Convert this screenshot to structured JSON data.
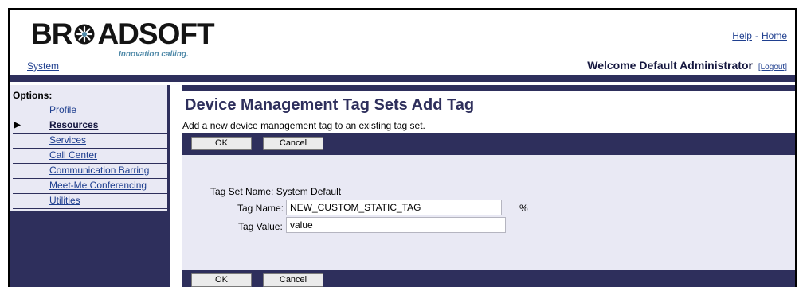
{
  "brand": {
    "logo_text_left": "BR",
    "logo_text_right": "ADSOFT",
    "tagline": "Innovation calling."
  },
  "header": {
    "help_label": "Help",
    "link_separator": "-",
    "home_label": "Home",
    "system_label": "System",
    "welcome_text": "Welcome Default Administrator",
    "logout_label": "[Logout]"
  },
  "sidebar": {
    "options_label": "Options:",
    "items": [
      {
        "label": "Profile",
        "active": false
      },
      {
        "label": "Resources",
        "active": true
      },
      {
        "label": "Services",
        "active": false
      },
      {
        "label": "Call Center",
        "active": false
      },
      {
        "label": "Communication Barring",
        "active": false
      },
      {
        "label": "Meet-Me Conferencing",
        "active": false
      },
      {
        "label": "Utilities",
        "active": false
      }
    ]
  },
  "main": {
    "title": "Device Management Tag Sets Add Tag",
    "description": "Add a new device management tag to an existing tag set.",
    "ok_label": "OK",
    "cancel_label": "Cancel",
    "form": {
      "tag_set_name_label": "Tag Set Name:",
      "tag_set_name_value": "System Default",
      "tag_name_label": "Tag Name:",
      "tag_name_prefix": "%",
      "tag_name_value": "NEW_CUSTOM_STATIC_TAG",
      "tag_name_suffix": "%",
      "tag_value_label": "Tag Value:",
      "tag_value_value": "value"
    }
  },
  "colors": {
    "dark_navy": "#2e2f5c",
    "panel_lavender": "#e9e9f4",
    "link_blue": "#1f3f8f",
    "tagline_teal": "#4f89a8"
  }
}
